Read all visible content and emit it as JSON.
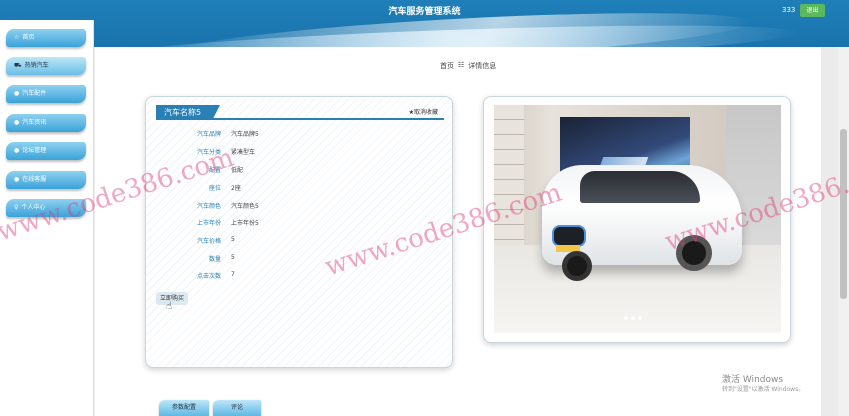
{
  "header": {
    "title": "汽车服务管理系统",
    "username": "333",
    "logout_label": "退出"
  },
  "sidebar": {
    "items": [
      {
        "icon": "star-icon",
        "label": "首页",
        "glyph": "☆"
      },
      {
        "icon": "car-icon",
        "label": "热销汽车",
        "glyph": "🚗"
      },
      {
        "icon": "dot-icon",
        "label": "汽车配件",
        "glyph": "●"
      },
      {
        "icon": "dot-icon",
        "label": "汽车资讯",
        "glyph": "●"
      },
      {
        "icon": "dot-icon",
        "label": "论坛管理",
        "glyph": "●"
      },
      {
        "icon": "dot-icon",
        "label": "在线客服",
        "glyph": "●"
      },
      {
        "icon": "user-icon",
        "label": "个人中心",
        "glyph": "♀"
      }
    ]
  },
  "breadcrumb": {
    "home": "首页",
    "separator": "☷",
    "current": "详情信息"
  },
  "detail": {
    "title": "汽车名称5",
    "favorite_label": "★取消收藏",
    "fields": [
      {
        "label": "汽车品牌",
        "value": "汽车品牌5"
      },
      {
        "label": "汽车分类",
        "value": "紧凑型车"
      },
      {
        "label": "配置",
        "value": "低配"
      },
      {
        "label": "座位",
        "value": "2座"
      },
      {
        "label": "汽车颜色",
        "value": "汽车颜色5"
      },
      {
        "label": "上市年份",
        "value": "上市年份5"
      },
      {
        "label": "汽车价格",
        "value": "5"
      },
      {
        "label": "数量",
        "value": "5"
      },
      {
        "label": "点击次数",
        "value": "7"
      }
    ],
    "buy_label": "立即购买"
  },
  "tabs": [
    {
      "label": "参数配置"
    },
    {
      "label": "评论"
    }
  ],
  "watermark": "www.code386.com",
  "os_notice": {
    "title": "激活 Windows",
    "subtitle": "转到\"设置\"以激活 Windows。"
  }
}
